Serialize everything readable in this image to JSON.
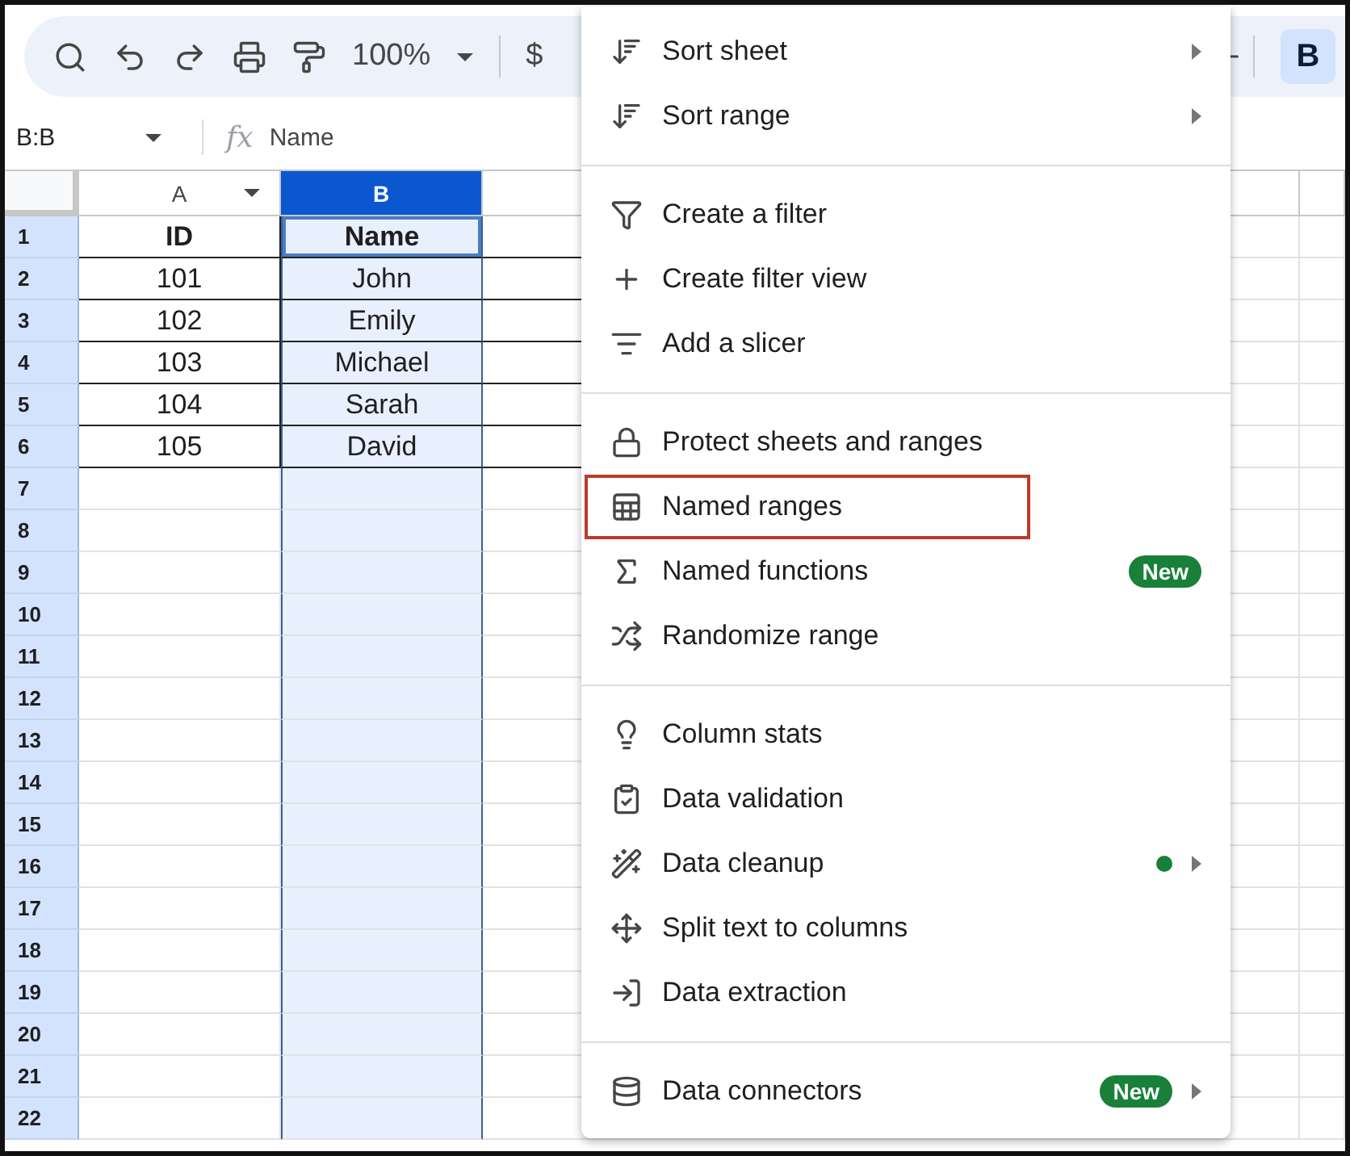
{
  "toolbar": {
    "zoom": "100%",
    "currency": "$",
    "bold_button": {
      "label": "B",
      "selected": true
    }
  },
  "formula_bar": {
    "cell_reference": "B:B",
    "function_label": "fx",
    "value": "Name"
  },
  "grid": {
    "columns": [
      {
        "label": "A",
        "selected": false
      },
      {
        "label": "B",
        "selected": true
      },
      {
        "selected": false
      }
    ],
    "rows": [
      {
        "number": "1",
        "cells": [
          "ID",
          "Name"
        ]
      },
      {
        "number": "2",
        "cells": [
          "101",
          "John"
        ]
      },
      {
        "number": "3",
        "cells": [
          "102",
          "Emily"
        ]
      },
      {
        "number": "4",
        "cells": [
          "103",
          "Michael"
        ]
      },
      {
        "number": "5",
        "cells": [
          "104",
          "Sarah"
        ]
      },
      {
        "number": "6",
        "cells": [
          "105",
          "David"
        ]
      },
      {
        "number": "7"
      },
      {
        "number": "8"
      },
      {
        "number": "9"
      },
      {
        "number": "10"
      },
      {
        "number": "11"
      },
      {
        "number": "12"
      },
      {
        "number": "13"
      },
      {
        "number": "14"
      },
      {
        "number": "15"
      },
      {
        "number": "16"
      },
      {
        "number": "17"
      },
      {
        "number": "18"
      },
      {
        "number": "19"
      },
      {
        "number": "20"
      },
      {
        "number": "21"
      },
      {
        "number": "22"
      }
    ]
  },
  "menu": {
    "items": [
      {
        "label": "Sort sheet",
        "submenu": true,
        "divider_before": false,
        "highlighted": false
      },
      {
        "label": "Sort range",
        "submenu": true,
        "divider_before": false,
        "highlighted": false
      },
      {
        "label": "Create a filter",
        "submenu": false,
        "divider_before": true,
        "highlighted": false
      },
      {
        "label": "Create filter view",
        "submenu": false,
        "divider_before": false,
        "highlighted": false
      },
      {
        "label": "Add a slicer",
        "submenu": false,
        "divider_before": false,
        "highlighted": false
      },
      {
        "label": "Protect sheets and ranges",
        "submenu": false,
        "divider_before": true,
        "highlighted": false
      },
      {
        "label": "Named ranges",
        "submenu": false,
        "divider_before": false,
        "highlighted": true
      },
      {
        "label": "Named functions",
        "submenu": false,
        "divider_before": false,
        "highlighted": false,
        "badge": "New"
      },
      {
        "label": "Randomize range",
        "submenu": false,
        "divider_before": false,
        "highlighted": false
      },
      {
        "label": "Column stats",
        "submenu": false,
        "divider_before": true,
        "highlighted": false
      },
      {
        "label": "Data validation",
        "submenu": false,
        "divider_before": false,
        "highlighted": false
      },
      {
        "label": "Data cleanup",
        "submenu": true,
        "divider_before": false,
        "highlighted": false,
        "color": "#188038"
      },
      {
        "label": "Split text to columns",
        "submenu": false,
        "divider_before": false,
        "highlighted": false
      },
      {
        "label": "Data extraction",
        "submenu": false,
        "divider_before": false,
        "highlighted": false
      },
      {
        "label": "Data connectors",
        "submenu": true,
        "divider_before": true,
        "highlighted": false,
        "badge": "New"
      }
    ]
  }
}
